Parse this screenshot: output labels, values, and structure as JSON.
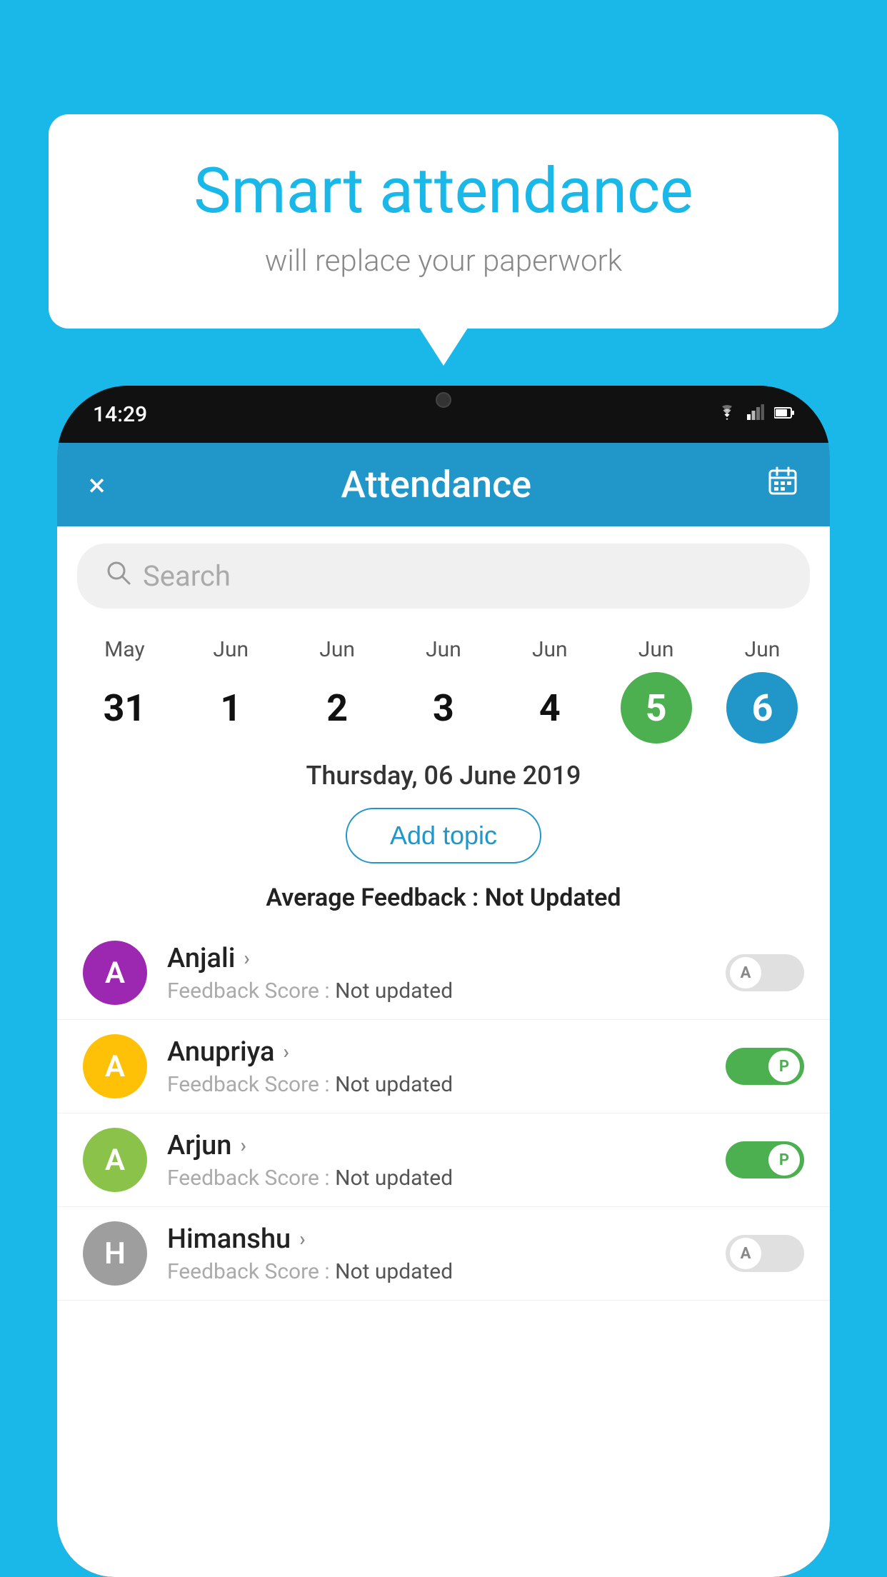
{
  "background_color": "#1ab8e8",
  "speech_bubble": {
    "title": "Smart attendance",
    "subtitle": "will replace your paperwork"
  },
  "phone": {
    "status_bar": {
      "time": "14:29",
      "icons": [
        "wifi",
        "signal",
        "battery"
      ]
    },
    "app_header": {
      "title": "Attendance",
      "close_label": "×",
      "calendar_icon": "📅"
    },
    "search": {
      "placeholder": "Search"
    },
    "calendar": {
      "days": [
        {
          "month": "May",
          "date": "31",
          "state": "normal"
        },
        {
          "month": "Jun",
          "date": "1",
          "state": "normal"
        },
        {
          "month": "Jun",
          "date": "2",
          "state": "normal"
        },
        {
          "month": "Jun",
          "date": "3",
          "state": "normal"
        },
        {
          "month": "Jun",
          "date": "4",
          "state": "normal"
        },
        {
          "month": "Jun",
          "date": "5",
          "state": "today"
        },
        {
          "month": "Jun",
          "date": "6",
          "state": "selected"
        }
      ]
    },
    "selected_date": "Thursday, 06 June 2019",
    "add_topic_label": "Add topic",
    "avg_feedback_label": "Average Feedback :",
    "avg_feedback_value": "Not Updated",
    "students": [
      {
        "name": "Anjali",
        "initial": "A",
        "avatar_color": "#9c27b0",
        "feedback_label": "Feedback Score :",
        "feedback_value": "Not updated",
        "toggle_state": "off",
        "toggle_label": "A"
      },
      {
        "name": "Anupriya",
        "initial": "A",
        "avatar_color": "#ffc107",
        "feedback_label": "Feedback Score :",
        "feedback_value": "Not updated",
        "toggle_state": "on",
        "toggle_label": "P"
      },
      {
        "name": "Arjun",
        "initial": "A",
        "avatar_color": "#8bc34a",
        "feedback_label": "Feedback Score :",
        "feedback_value": "Not updated",
        "toggle_state": "on",
        "toggle_label": "P"
      },
      {
        "name": "Himanshu",
        "initial": "H",
        "avatar_color": "#9e9e9e",
        "feedback_label": "Feedback Score :",
        "feedback_value": "Not updated",
        "toggle_state": "off",
        "toggle_label": "A"
      }
    ]
  }
}
